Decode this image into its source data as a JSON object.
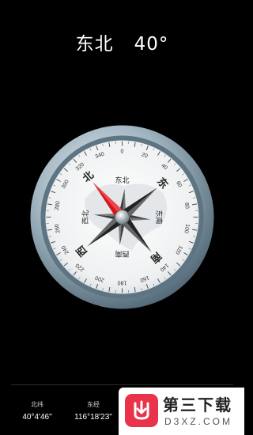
{
  "heading": {
    "direction": "东北",
    "degrees": "40°"
  },
  "compass": {
    "bearing_deg": 40,
    "ring_labels": [
      "0",
      "20",
      "40",
      "60",
      "80",
      "100",
      "120",
      "140",
      "160",
      "180",
      "200",
      "220",
      "240",
      "260",
      "280",
      "300",
      "320",
      "340"
    ],
    "cardinals": {
      "north": "北",
      "east": "东",
      "south": "南",
      "west": "西"
    },
    "intercardinals": {
      "ne": "东北",
      "se": "东南",
      "sw": "西南",
      "nw": "西北"
    },
    "colors": {
      "north_needle": "#d8141d",
      "needle_dark": "#1f1f1f",
      "bezel": "#8ea6b4"
    }
  },
  "location": {
    "lat_label": "北纬",
    "lat_value": "40°4'46\"",
    "lng_label": "东经",
    "lng_value": "116°18'23\""
  },
  "watermark": {
    "title": "第三下载",
    "subtitle": "D3XZ.COM",
    "icon": "download-logo-icon"
  }
}
